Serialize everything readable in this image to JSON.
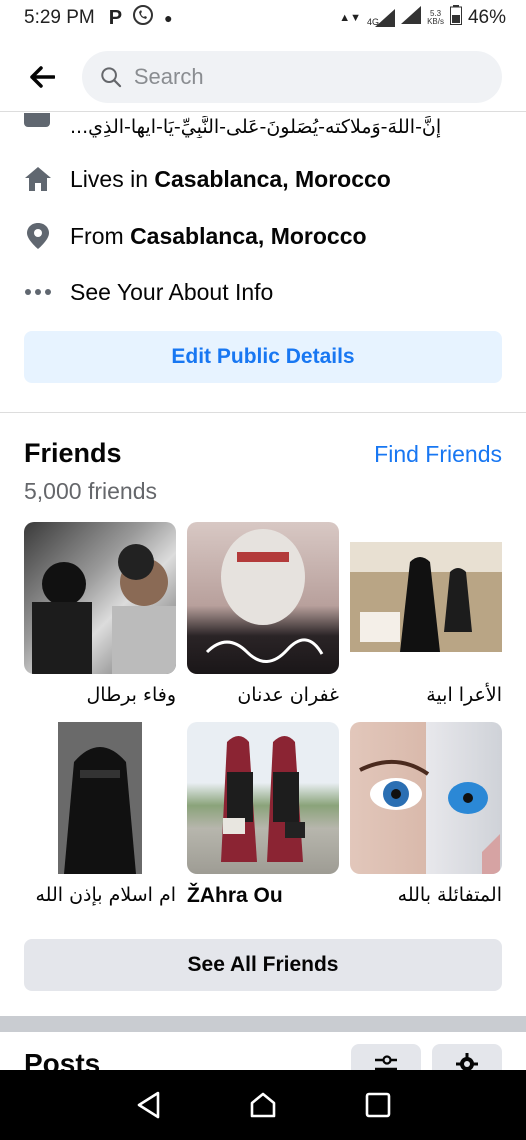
{
  "status_bar": {
    "time": "5:29 PM",
    "network": "4G",
    "speed_value": "5.3",
    "speed_unit": "KB/s",
    "battery": "46%"
  },
  "search": {
    "placeholder": "Search"
  },
  "bio": {
    "text": "إنَّ-اللهَ-وَملاكته-يُصَلونَ-عَلى-النَّبِيِّ-يَا-ايها-الذِي..."
  },
  "intro": {
    "lives_prefix": "Lives in ",
    "lives_place": "Casablanca, Morocco",
    "from_prefix": "From ",
    "from_place": "Casablanca, Morocco",
    "about_label": "See Your About Info",
    "edit_button": "Edit Public Details"
  },
  "friends": {
    "title": "Friends",
    "count": "5,000 friends",
    "find_link": "Find Friends",
    "items": [
      {
        "name": "وفاء برطال"
      },
      {
        "name": "غفران عدنان"
      },
      {
        "name": "الأعرا ابية"
      },
      {
        "name": "ام اسلام بإذن الله"
      },
      {
        "name": "ŽAhra Ou"
      },
      {
        "name": "المتفائلة بالله"
      }
    ],
    "see_all": "See All Friends"
  },
  "posts": {
    "title": "Posts"
  },
  "colors": {
    "accent": "#1877f2",
    "accent_bg": "#e7f3ff",
    "button_gray": "#e4e6eb",
    "secondary_text": "#65676b"
  },
  "icons": [
    "back-arrow-icon",
    "search-icon",
    "home-icon",
    "location-pin-icon",
    "more-dots-icon",
    "filter-icon",
    "gear-icon",
    "nav-back-icon",
    "nav-home-icon",
    "nav-recents-icon"
  ]
}
